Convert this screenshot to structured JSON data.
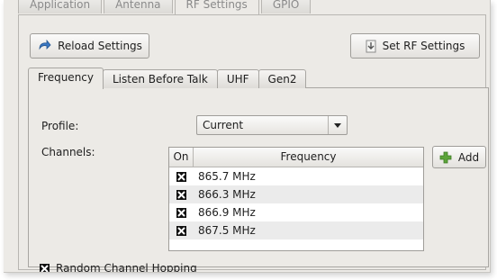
{
  "top_tabs": [
    "Application",
    "Antenna",
    "RF Settings",
    "GPIO"
  ],
  "toolbar": {
    "reload_label": "Reload Settings",
    "set_rf_label": "Set RF Settings"
  },
  "inner_tabs": [
    "Frequency",
    "Listen Before Talk",
    "UHF",
    "Gen2"
  ],
  "frequency": {
    "profile_label": "Profile:",
    "profile_value": "Current",
    "channels_label": "Channels:",
    "columns": [
      "On",
      "Frequency"
    ],
    "channels": [
      {
        "on": true,
        "frequency": "865.7 MHz"
      },
      {
        "on": true,
        "frequency": "866.3 MHz"
      },
      {
        "on": true,
        "frequency": "866.9 MHz"
      },
      {
        "on": true,
        "frequency": "867.5 MHz"
      }
    ],
    "add_label": "Add",
    "hopping_label": "Random Channel Hopping",
    "hopping_checked": true
  },
  "icons": {
    "reload": "reload-arrow-icon",
    "set_rf": "download-icon",
    "add": "green-plus-icon",
    "dropdown": "chevron-down-icon",
    "check": "checkbox-x-icon"
  },
  "colors": {
    "accent_green": "#5ca43a",
    "reload_blue": "#3b78c4"
  }
}
